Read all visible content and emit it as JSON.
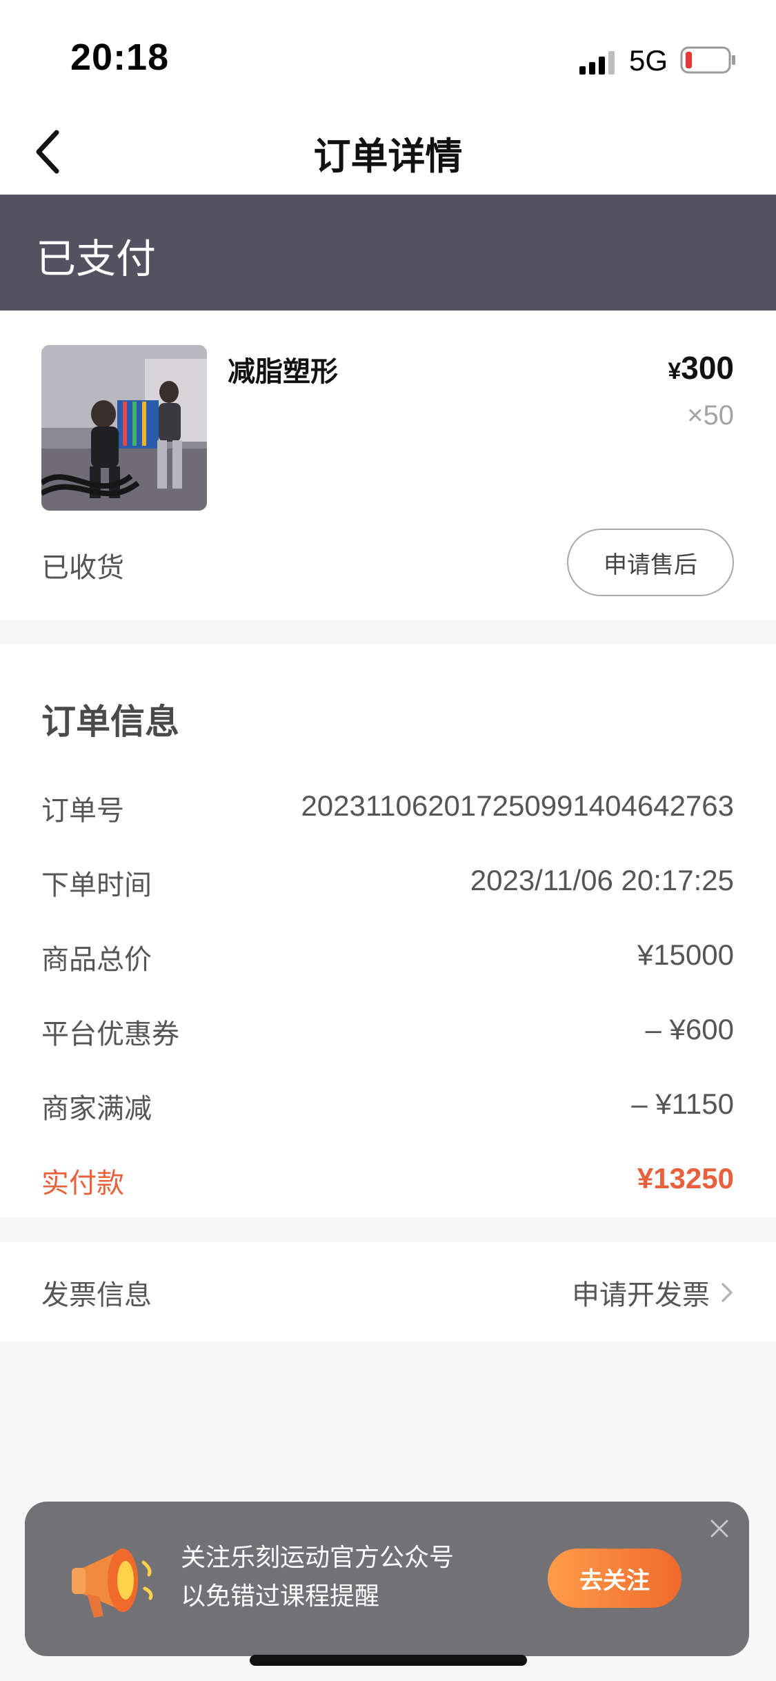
{
  "status_bar": {
    "time": "20:18",
    "network": "5G"
  },
  "nav": {
    "title": "订单详情"
  },
  "banner": {
    "status": "已支付"
  },
  "product": {
    "name": "减脂塑形",
    "price_symbol": "¥",
    "price": "300",
    "quantity": "×50",
    "delivery_status": "已收货",
    "after_sale_label": "申请售后"
  },
  "order_info": {
    "title": "订单信息",
    "rows": [
      {
        "label": "订单号",
        "value": "20231106201725099140464​2763"
      },
      {
        "label": "下单时间",
        "value": "2023/11/06 20:17:25"
      },
      {
        "label": "商品总价",
        "value": "¥15000"
      },
      {
        "label": "平台优惠券",
        "value": "– ¥600"
      },
      {
        "label": "商家满减",
        "value": "– ¥1150"
      },
      {
        "label": "实付款",
        "value": "¥13250"
      }
    ]
  },
  "invoice": {
    "label": "发票信息",
    "action": "申请开发票"
  },
  "follow_toast": {
    "line1": "关注乐刻运动官方公众号",
    "line2": "以免错过课程提醒",
    "button": "去关注"
  },
  "colors": {
    "banner": "#545260",
    "accent": "#e8603c",
    "toast": "#717176",
    "follow_button": "#f06a2c"
  }
}
